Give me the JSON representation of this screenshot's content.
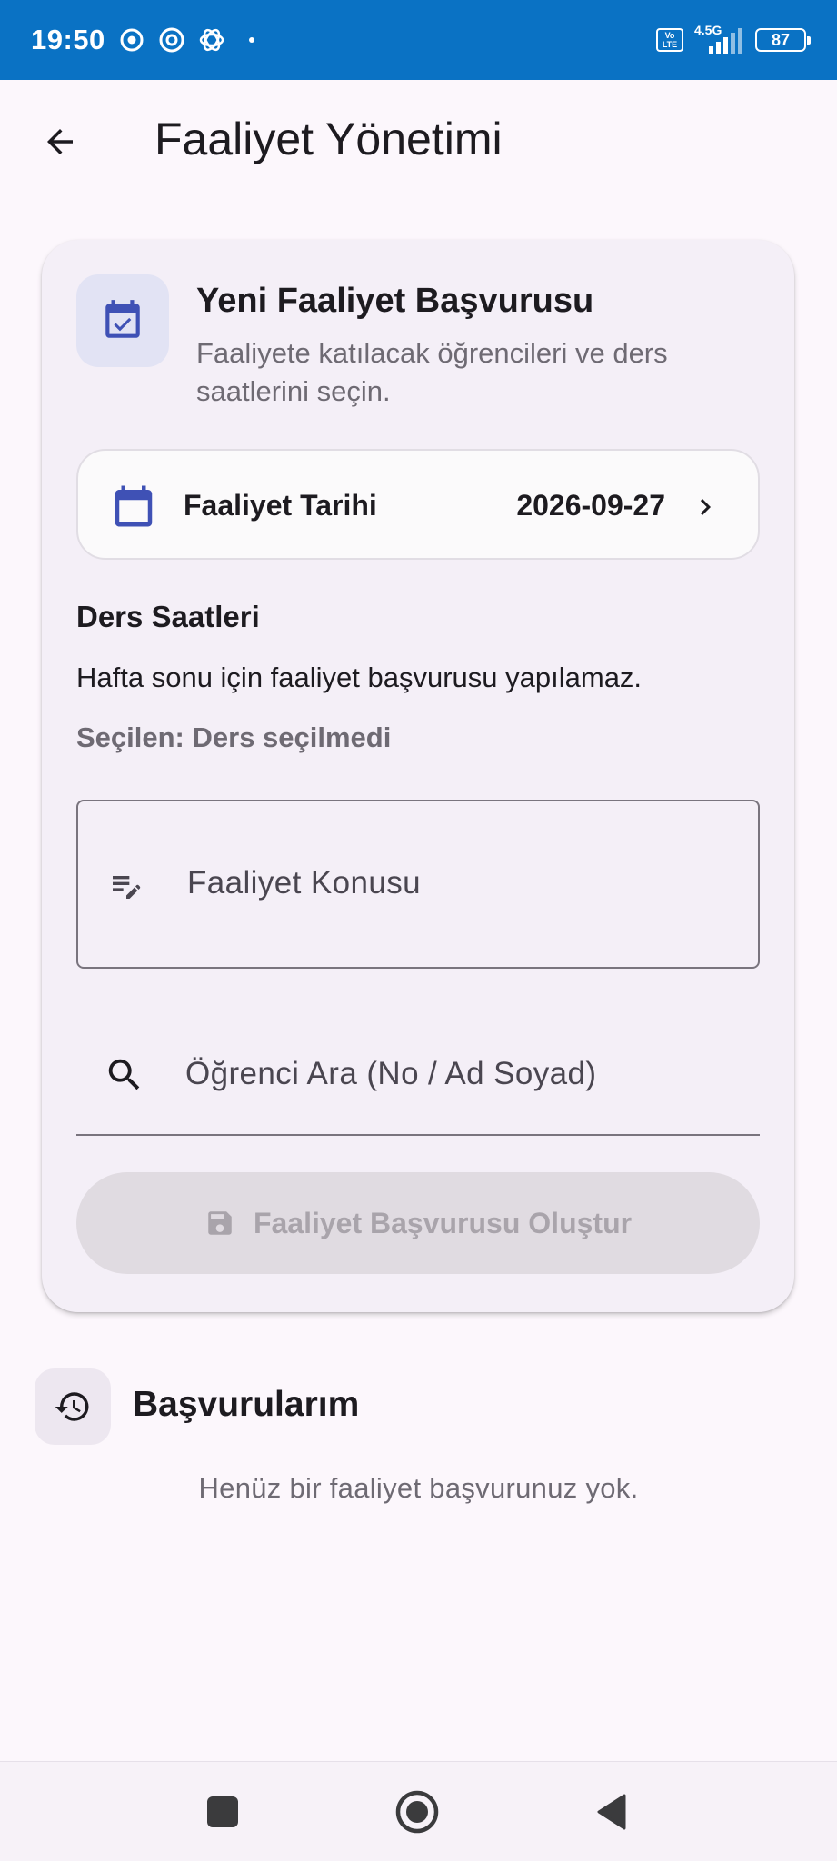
{
  "status_bar": {
    "time": "19:50",
    "network": "4.5G",
    "volte": "Vo LTE",
    "battery": "87",
    "icons": [
      "chrome-icon",
      "threads-icon",
      "openai-icon",
      "dot-icon"
    ]
  },
  "app_bar": {
    "title": "Faaliyet Yönetimi"
  },
  "new_application": {
    "title": "Yeni Faaliyet Başvurusu",
    "subtitle": "Faaliyete katılacak öğrencileri ve ders saatlerini seçin.",
    "date_label": "Faaliyet Tarihi",
    "date_value": "2026-09-27",
    "lessons_title": "Ders Saatleri",
    "weekend_note": "Hafta sonu için faaliyet başvurusu yapılamaz.",
    "selected_text": "Seçilen: Ders seçilmedi",
    "topic_placeholder": "Faaliyet Konusu",
    "search_placeholder": "Öğrenci Ara (No / Ad Soyad)",
    "submit_label": "Faaliyet Başvurusu Oluştur"
  },
  "history": {
    "title": "Başvurularım",
    "empty_text": "Henüz bir faaliyet başvurunuz yok."
  },
  "colors": {
    "status_bar": "#0a72c4",
    "accent": "#3f51b5",
    "background": "#fcf7fc",
    "card": "#f4eff7"
  }
}
